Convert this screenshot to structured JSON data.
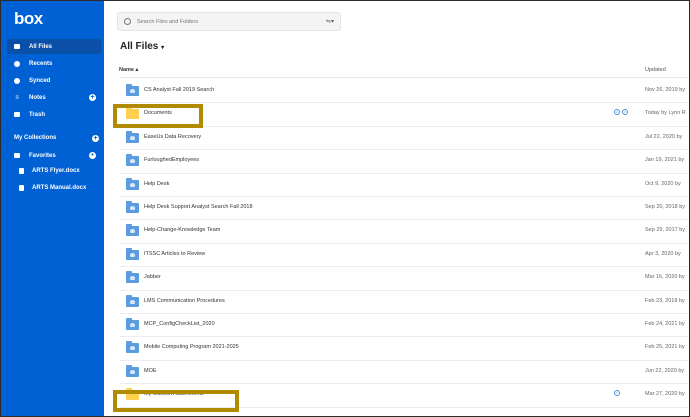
{
  "app": {
    "logo": "box"
  },
  "sidebar": {
    "items": [
      {
        "label": "All Files",
        "icon": "folder-icon",
        "active": true
      },
      {
        "label": "Recents",
        "icon": "clock-icon"
      },
      {
        "label": "Synced",
        "icon": "check-circle-icon"
      },
      {
        "label": "Notes",
        "icon": "notes-icon",
        "has_add": true
      },
      {
        "label": "Trash",
        "icon": "trash-icon"
      }
    ],
    "collections_title": "My Collections",
    "favorites_label": "Favorites",
    "favorites": [
      {
        "label": "ARTS Flyer.docx",
        "icon": "doc-icon"
      },
      {
        "label": "ARTS Manual.docx",
        "icon": "doc-icon"
      }
    ]
  },
  "search": {
    "placeholder": "Search Files and Folders"
  },
  "main": {
    "title": "All Files",
    "title_suffix": "▾",
    "columns": {
      "name": "Name",
      "name_sort": "▴",
      "updated": "Updated"
    },
    "rows": [
      {
        "name": "CS Analyst Fall 2019 Search",
        "updated": "Nov 26, 2019 by",
        "color": "blue"
      },
      {
        "name": "Documents",
        "updated": "Today by Lynn R",
        "color": "yellow"
      },
      {
        "name": "EaseUs Data Recovery",
        "updated": "Jul 22, 2020 by",
        "color": "blue"
      },
      {
        "name": "FurloughedEmployees",
        "updated": "Jan 19, 2021 by",
        "color": "blue"
      },
      {
        "name": "Help Desk",
        "updated": "Oct 9, 2020 by",
        "color": "blue"
      },
      {
        "name": "Help Desk Support Analyst Search Fall 2018",
        "updated": "Sep 20, 2018 by",
        "color": "blue"
      },
      {
        "name": "Help-Change-Knowledge Team",
        "updated": "Sep 29, 2017 by",
        "color": "blue"
      },
      {
        "name": "ITSSC Articles to Review",
        "updated": "Apr 3, 2020 by",
        "color": "blue"
      },
      {
        "name": "Jabber",
        "updated": "Mar 16, 2020 by",
        "color": "blue"
      },
      {
        "name": "LMS Communication Procedures",
        "updated": "Feb 23, 2018 by",
        "color": "blue"
      },
      {
        "name": "MCP_ConfigCheckList_2020",
        "updated": "Feb 24, 2021 by",
        "color": "blue"
      },
      {
        "name": "Mobile Computing Program 2021-2025",
        "updated": "Feb 25, 2021 by",
        "color": "blue"
      },
      {
        "name": "MOE",
        "updated": "Jun 22, 2020 by",
        "color": "blue"
      },
      {
        "name": "My Outlook Attachments",
        "updated": "Mar 27, 2020 by",
        "color": "yellow"
      }
    ]
  },
  "colors": {
    "sidebar": "#0061d5",
    "highlight": "#b28a00",
    "folder_blue": "#5a9cdf",
    "folder_yellow": "#ffd04e"
  }
}
